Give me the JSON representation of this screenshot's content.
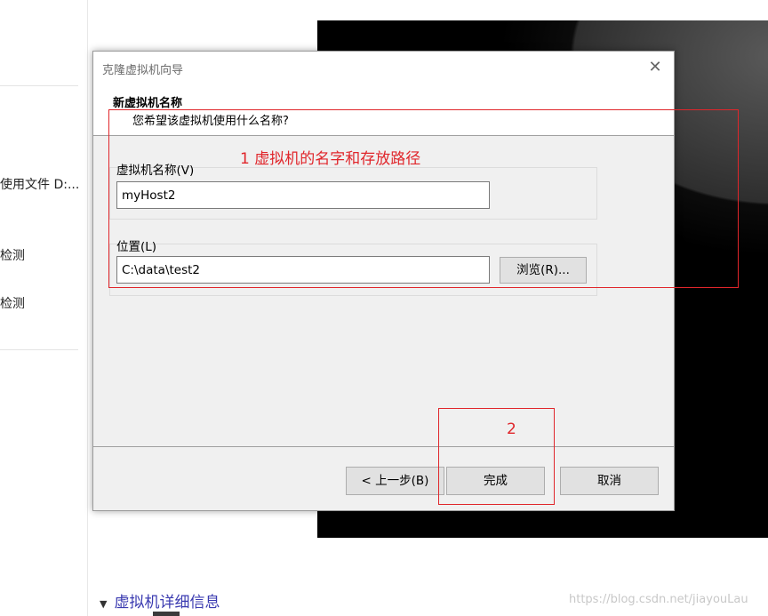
{
  "background": {
    "left_items": [
      "使用文件 D:...",
      "检测",
      "检测"
    ],
    "details_section": "虚拟机详细信息"
  },
  "dialog": {
    "title": "克隆虚拟机向导",
    "close_glyph": "✕",
    "header_title": "新虚拟机名称",
    "header_subtitle": "您希望该虚拟机使用什么名称?",
    "name_label": "虚拟机名称(V)",
    "name_value": "myHost2",
    "location_label": "位置(L)",
    "location_value": "C:\\data\\test2",
    "browse_button": "浏览(R)...",
    "back_button": "< 上一步(B)",
    "finish_button": "完成",
    "cancel_button": "取消"
  },
  "annotations": {
    "note1": "1 虚拟机的名字和存放路径",
    "note2": "2",
    "color": "#e0262b"
  },
  "watermark": "https://blog.csdn.net/jiayouLau"
}
